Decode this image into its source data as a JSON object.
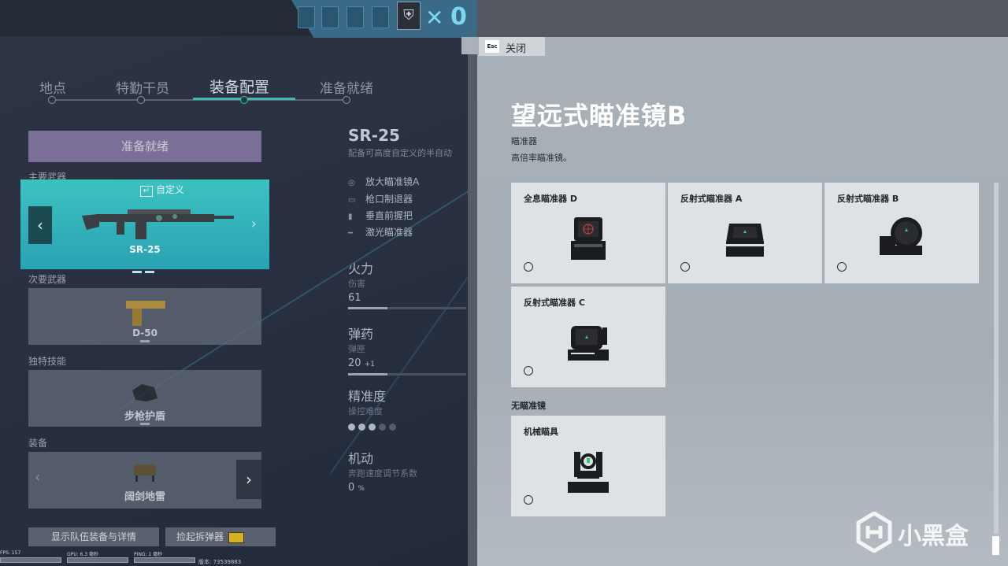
{
  "steps": [
    "地点",
    "特勤干员",
    "装备配置",
    "准备就绪"
  ],
  "ready_button": "准备就绪",
  "sections": {
    "primary": "主要武器",
    "secondary": "次要武器",
    "unique": "独特技能",
    "gadget": "装备"
  },
  "primary": {
    "custom_label": "自定义",
    "name": "SR-25"
  },
  "secondary": {
    "name": "D-50"
  },
  "unique": {
    "name": "步枪护盾"
  },
  "gadget": {
    "name": "阔剑地雷"
  },
  "bottom_buttons": {
    "team": "显示队伍装备与详情",
    "defuser": "捡起拆弹器"
  },
  "perf": {
    "fps_label": "FPS: 157",
    "gpu_label": "GPU: 6.3 毫秒",
    "ping_label": "PING: 1 毫秒",
    "version": "版本: 73539883"
  },
  "weapon": {
    "title": "SR-25",
    "desc": "配备可高度自定义的半自动",
    "attachments": [
      "放大瞄准镜A",
      "枪口制退器",
      "垂直前握把",
      "激光瞄准器"
    ],
    "stats": {
      "firepower": {
        "title": "火力",
        "sub": "伤害",
        "value": "61",
        "fraction": 0.33
      },
      "ammo": {
        "title": "弹药",
        "sub": "弹匣",
        "value": "20",
        "extra": "+1",
        "fraction": 0.33
      },
      "accuracy": {
        "title": "精准度",
        "sub": "操控难度",
        "filled": 3,
        "total": 5
      },
      "mobility": {
        "title": "机动",
        "sub": "奔跑速度调节系数",
        "value": "0",
        "unit": "%"
      }
    }
  },
  "panel": {
    "close_key": "Esc",
    "close_label": "关闭",
    "title": "望远式瞄准镜B",
    "category": "瞄准器",
    "description": "高倍率瞄准镜。",
    "options": [
      {
        "name": "全息瞄准器 D"
      },
      {
        "name": "反射式瞄准器 A"
      },
      {
        "name": "反射式瞄准器 B"
      },
      {
        "name": "反射式瞄准器 C"
      }
    ],
    "no_scope_header": "无瞄准镜",
    "iron_sight": {
      "name": "机械瞄具"
    }
  },
  "watermark": "小黑盒",
  "colors": {
    "accent_teal": "#44b8b0",
    "ready_purple": "#8a7aa6",
    "reticle_green": "#2ecc71",
    "reticle_red": "#d04040"
  }
}
